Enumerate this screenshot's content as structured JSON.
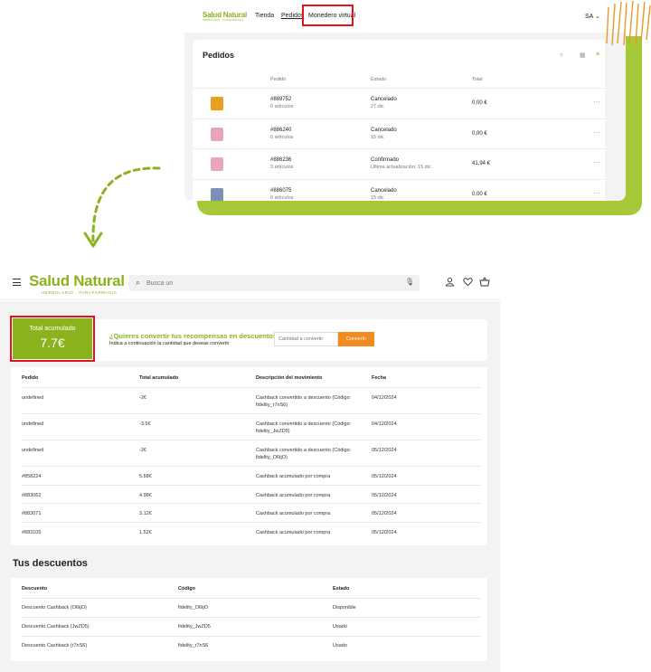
{
  "top": {
    "logo": "Salud Natural",
    "logo_sub": "HERBOLARIO · PARAFARMACIA",
    "nav": {
      "tienda": "Tienda",
      "pedidos": "Pedidos",
      "monedero": "Monedero virtual",
      "user": "SA"
    },
    "orders_title": "Pedidos",
    "headers": {
      "pedido": "Pedido",
      "estado": "Estado",
      "total": "Total"
    },
    "orders": [
      {
        "num": "#889752",
        "items": "0 artículos",
        "state": "Cancelado",
        "date": "27 dic",
        "total": "0,00 €",
        "thumb_color": "#e8a020"
      },
      {
        "num": "#886240",
        "items": "0 artículos",
        "state": "Cancelado",
        "date": "15 dic",
        "total": "0,00 €",
        "thumb_color": "#e7a7b9"
      },
      {
        "num": "#886236",
        "items": "3 artículos",
        "state": "Confirmado",
        "date": "Última actualización: 15 dic",
        "total": "41,94 €",
        "thumb_color": "#e7a7b9"
      },
      {
        "num": "#886075",
        "items": "0 artículos",
        "state": "Cancelado",
        "date": "15 dic",
        "total": "0,00 €",
        "thumb_color": "#7a90b8"
      }
    ],
    "more": "···"
  },
  "header": {
    "logo": "Salud Natural",
    "logo_tag": "HERBOLARIO · PARAFARMACIA",
    "search_placeholder": "Busca un"
  },
  "wallet": {
    "acc_label": "Total acumulado",
    "acc_value": "7.7€",
    "question": "¿Quieres convertir tus recompensas en descuentos?",
    "hint": "Indica a continuación la cantidad que deseas convertir",
    "qty_placeholder": "Cantidad a convertir",
    "convert_label": "Convertir"
  },
  "movements": {
    "headers": {
      "pedido": "Pedido",
      "total": "Total acumulado",
      "desc": "Descripción del movimiento",
      "fecha": "Fecha"
    },
    "rows": [
      {
        "pedido": "undefined",
        "total": "-2€",
        "desc": "Cashback convertido a descuento (Código: fidelity_r7nS6)",
        "fecha": "04/12/2024"
      },
      {
        "pedido": "undefined",
        "total": "-3.5€",
        "desc": "Cashback convertido a descuento (Código: fidelity_JwZD5)",
        "fecha": "04/12/2024"
      },
      {
        "pedido": "undefined",
        "total": "-2€",
        "desc": "Cashback convertido a descuento (Código: fidelity_O6tjO)",
        "fecha": "05/12/2024"
      },
      {
        "pedido": "#858224",
        "total": "5.58€",
        "desc": "Cashback acumulado por compra",
        "fecha": "05/12/2024"
      },
      {
        "pedido": "#883062",
        "total": "4.98€",
        "desc": "Cashback acumulado por compra",
        "fecha": "05/12/2024"
      },
      {
        "pedido": "#883071",
        "total": "3.12€",
        "desc": "Cashback acumulado por compra",
        "fecha": "05/12/2024"
      },
      {
        "pedido": "#883105",
        "total": "1.52€",
        "desc": "Cashback acumulado por compra",
        "fecha": "05/12/2024"
      }
    ]
  },
  "discounts": {
    "title": "Tus descuentos",
    "headers": {
      "desc": "Descuento",
      "code": "Código",
      "state": "Estado"
    },
    "rows": [
      {
        "desc": "Descuento Cashback (O6tjO)",
        "code": "fidelity_O6tjO",
        "state": "Disponible"
      },
      {
        "desc": "Descuento Cashback (JwZD5)",
        "code": "fidelity_JwZD5",
        "state": "Usado"
      },
      {
        "desc": "Descuento Cashback (r7nS6)",
        "code": "fidelity_r7nS6",
        "state": "Usado"
      }
    ]
  },
  "colors": {
    "brand_green": "#8bb31d",
    "accent_orange": "#f28a1d",
    "highlight_red": "#e0141e",
    "slab_green": "#a6c93a"
  }
}
